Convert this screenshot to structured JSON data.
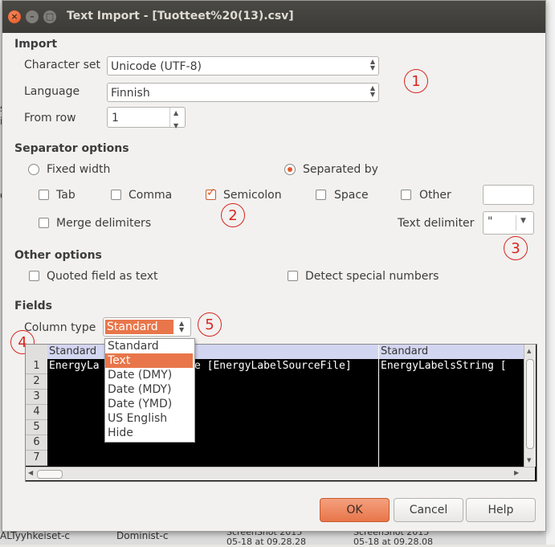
{
  "window": {
    "title": "Text Import - [Tuotteet%20(13).csv]",
    "close_glyph": "×",
    "min_glyph": "–",
    "max_glyph": "□"
  },
  "background": {
    "fragments": [
      "st",
      "is",
      "ls",
      "os",
      "a",
      "Ko",
      "ne",
      "ALTyyhkeiset-c",
      "Dominist-c",
      "ScreenShot 2015",
      "ScreenShot 2015",
      "05-18 at 09.28.28",
      "05-18 at 09.28.08"
    ]
  },
  "import": {
    "section": "Import",
    "charset_label": "Character set",
    "charset_value": "Unicode (UTF-8)",
    "language_label": "Language",
    "language_value": "Finnish",
    "fromrow_label": "From row",
    "fromrow_value": "1"
  },
  "separator": {
    "section": "Separator options",
    "fixed_width": "Fixed width",
    "separated_by": "Separated by",
    "tab": "Tab",
    "comma": "Comma",
    "semicolon": "Semicolon",
    "space": "Space",
    "other": "Other",
    "merge": "Merge delimiters",
    "text_delim_label": "Text delimiter",
    "text_delim_value": "\""
  },
  "other": {
    "section": "Other options",
    "quoted": "Quoted field as text",
    "detect": "Detect special numbers"
  },
  "fields": {
    "section": "Fields",
    "column_type_label": "Column type",
    "column_type_value": "Standard",
    "col_headers": [
      "Standard",
      "Standard"
    ],
    "row_numbers": [
      "1",
      "2",
      "3",
      "4",
      "5",
      "6",
      "7"
    ],
    "row1_col1": "EnergyLa",
    "row1_col1b": "e [EnergyLabelSourceFile]",
    "row1_col2": "EnergyLabelsString ["
  },
  "dropdown": {
    "options": [
      "Standard",
      "Text",
      "Date (DMY)",
      "Date (MDY)",
      "Date (YMD)",
      "US English",
      "Hide"
    ],
    "selected": "Text"
  },
  "annotations": [
    "1",
    "2",
    "3",
    "4",
    "5"
  ],
  "buttons": {
    "ok": "OK",
    "cancel": "Cancel",
    "help": "Help"
  },
  "colors": {
    "accent": "#e8764a",
    "annotation": "#d7261e",
    "titlebar": "#3c3b37"
  }
}
